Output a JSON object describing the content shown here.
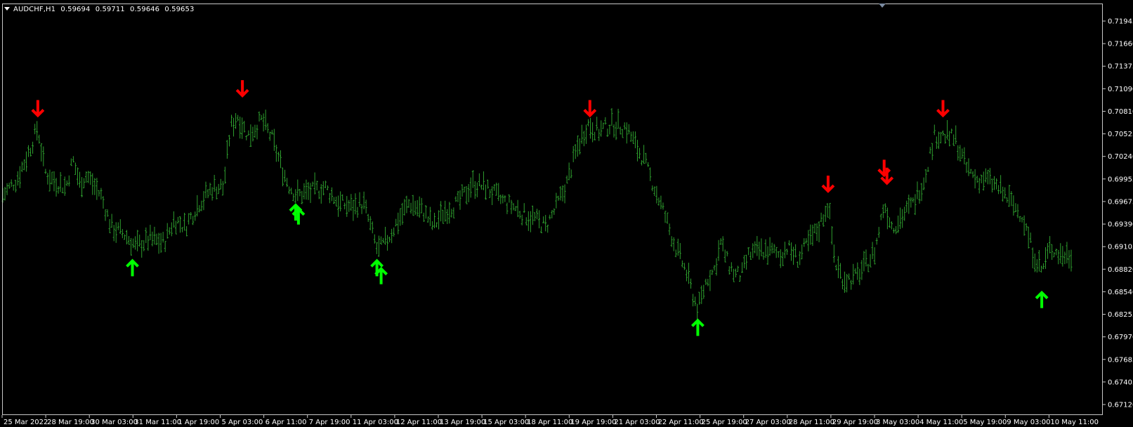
{
  "header": {
    "symbol": "AUDCHF,H1",
    "open": "0.59694",
    "high": "0.59711",
    "low": "0.59646",
    "close": "0.59653"
  },
  "colors": {
    "background": "#000000",
    "bars": "#2e9e2e",
    "arrow_up": "#00ff00",
    "arrow_down": "#ff0000",
    "axis_text": "#ffffff",
    "frame": "#c8c8c8"
  },
  "chart_data": {
    "type": "line",
    "symbol": "AUDCHF",
    "timeframe": "H1",
    "style": "OHLC bars",
    "ylim": [
      0.6712,
      0.7194
    ],
    "y_ticks": [
      "0.71945",
      "0.71660",
      "0.71375",
      "0.71090",
      "0.70810",
      "0.70525",
      "0.70240",
      "0.69955",
      "0.69675",
      "0.69390",
      "0.69105",
      "0.68820",
      "0.68540",
      "0.68255",
      "0.67970",
      "0.67685",
      "0.67405",
      "0.67120"
    ],
    "x_ticks": [
      "25 Mar 2022",
      "28 Mar 19:00",
      "30 Mar 03:00",
      "31 Mar 11:00",
      "1 Apr 19:00",
      "5 Apr 03:00",
      "6 Apr 11:00",
      "7 Apr 19:00",
      "11 Apr 03:00",
      "12 Apr 11:00",
      "13 Apr 19:00",
      "15 Apr 03:00",
      "18 Apr 11:00",
      "19 Apr 19:00",
      "21 Apr 03:00",
      "22 Apr 11:00",
      "25 Apr 19:00",
      "27 Apr 03:00",
      "28 Apr 11:00",
      "29 Apr 19:00",
      "3 May 03:00",
      "4 May 11:00",
      "5 May 19:00",
      "9 May 03:00",
      "10 May 11:00"
    ],
    "x_index_range": [
      0,
      1000
    ],
    "price_path": [
      [
        0,
        0.6975
      ],
      [
        20,
        0.6995
      ],
      [
        35,
        0.7025
      ],
      [
        50,
        0.706
      ],
      [
        60,
        0.7005
      ],
      [
        70,
        0.6995
      ],
      [
        90,
        0.6985
      ],
      [
        100,
        0.702
      ],
      [
        110,
        0.699
      ],
      [
        120,
        0.7
      ],
      [
        140,
        0.6975
      ],
      [
        155,
        0.6935
      ],
      [
        175,
        0.6925
      ],
      [
        190,
        0.691
      ],
      [
        210,
        0.692
      ],
      [
        230,
        0.6915
      ],
      [
        245,
        0.6945
      ],
      [
        260,
        0.6935
      ],
      [
        280,
        0.6965
      ],
      [
        300,
        0.6985
      ],
      [
        315,
        0.6985
      ],
      [
        325,
        0.706
      ],
      [
        335,
        0.7075
      ],
      [
        350,
        0.705
      ],
      [
        370,
        0.707
      ],
      [
        385,
        0.7045
      ],
      [
        400,
        0.7005
      ],
      [
        410,
        0.6985
      ],
      [
        420,
        0.6975
      ],
      [
        440,
        0.698
      ],
      [
        460,
        0.6985
      ],
      [
        480,
        0.6965
      ],
      [
        500,
        0.696
      ],
      [
        515,
        0.6965
      ],
      [
        525,
        0.6935
      ],
      [
        535,
        0.6905
      ],
      [
        550,
        0.692
      ],
      [
        565,
        0.6945
      ],
      [
        580,
        0.6965
      ],
      [
        600,
        0.6955
      ],
      [
        615,
        0.6935
      ],
      [
        630,
        0.6955
      ],
      [
        650,
        0.6965
      ],
      [
        670,
        0.699
      ],
      [
        690,
        0.6985
      ],
      [
        710,
        0.697
      ],
      [
        730,
        0.696
      ],
      [
        745,
        0.695
      ],
      [
        760,
        0.6945
      ],
      [
        775,
        0.6935
      ],
      [
        790,
        0.696
      ],
      [
        805,
        0.699
      ],
      [
        820,
        0.7035
      ],
      [
        835,
        0.7065
      ],
      [
        850,
        0.7055
      ],
      [
        870,
        0.7065
      ],
      [
        890,
        0.706
      ],
      [
        905,
        0.7035
      ],
      [
        915,
        0.702
      ],
      [
        930,
        0.6985
      ],
      [
        945,
        0.695
      ],
      [
        960,
        0.691
      ],
      [
        975,
        0.688
      ],
      [
        992,
        0.683
      ],
      [
        1005,
        0.687
      ],
      [
        1015,
        0.688
      ],
      [
        1025,
        0.6915
      ],
      [
        1035,
        0.689
      ],
      [
        1045,
        0.6875
      ],
      [
        1055,
        0.6875
      ],
      [
        1065,
        0.69
      ],
      [
        1080,
        0.6905
      ],
      [
        1095,
        0.6905
      ],
      [
        1110,
        0.69
      ],
      [
        1120,
        0.691
      ],
      [
        1135,
        0.6895
      ],
      [
        1150,
        0.6915
      ],
      [
        1165,
        0.6935
      ],
      [
        1178,
        0.6965
      ],
      [
        1188,
        0.689
      ],
      [
        1200,
        0.687
      ],
      [
        1215,
        0.687
      ],
      [
        1230,
        0.6885
      ],
      [
        1245,
        0.6905
      ],
      [
        1258,
        0.6965
      ],
      [
        1270,
        0.6935
      ],
      [
        1285,
        0.695
      ],
      [
        1300,
        0.6965
      ],
      [
        1315,
        0.6995
      ],
      [
        1330,
        0.705
      ],
      [
        1345,
        0.705
      ],
      [
        1360,
        0.7045
      ],
      [
        1375,
        0.701
      ],
      [
        1390,
        0.6995
      ],
      [
        1405,
        0.6995
      ],
      [
        1420,
        0.6985
      ],
      [
        1440,
        0.6965
      ],
      [
        1455,
        0.695
      ],
      [
        1470,
        0.6905
      ],
      [
        1483,
        0.688
      ],
      [
        1495,
        0.691
      ],
      [
        1510,
        0.69
      ],
      [
        1525,
        0.69
      ]
    ],
    "signals": [
      {
        "type": "sell",
        "x": 50,
        "price": 0.707
      },
      {
        "type": "buy",
        "x": 185,
        "price": 0.6905
      },
      {
        "type": "sell",
        "x": 342,
        "price": 0.7095
      },
      {
        "type": "buy",
        "x": 418,
        "price": 0.6975
      },
      {
        "type": "buy",
        "x": 422,
        "price": 0.697
      },
      {
        "type": "buy",
        "x": 534,
        "price": 0.6905
      },
      {
        "type": "buy",
        "x": 540,
        "price": 0.6895
      },
      {
        "type": "sell",
        "x": 838,
        "price": 0.707
      },
      {
        "type": "buy",
        "x": 992,
        "price": 0.683
      },
      {
        "type": "sell",
        "x": 1178,
        "price": 0.6975
      },
      {
        "type": "sell",
        "x": 1258,
        "price": 0.6995
      },
      {
        "type": "sell",
        "x": 1262,
        "price": 0.6985
      },
      {
        "type": "sell",
        "x": 1342,
        "price": 0.707
      },
      {
        "type": "buy",
        "x": 1483,
        "price": 0.6865
      }
    ]
  }
}
